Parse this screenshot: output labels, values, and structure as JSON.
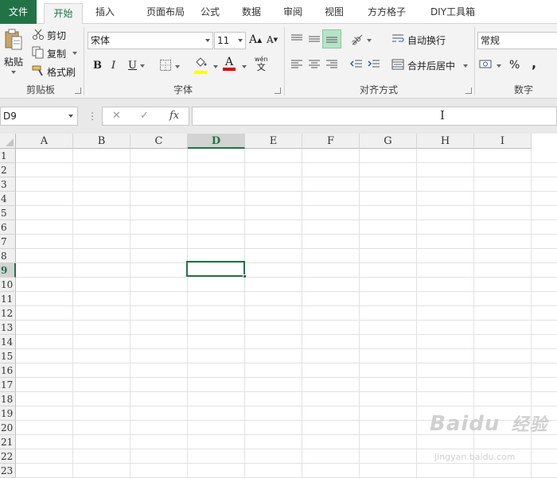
{
  "tabs": {
    "file": "文件",
    "home": "开始",
    "insert": "插入",
    "layout": "页面布局",
    "formulas": "公式",
    "data": "数据",
    "review": "审阅",
    "view": "视图",
    "fangfang": "方方格子",
    "diy": "DIY工具箱"
  },
  "clipboard": {
    "paste": "粘贴",
    "cut": "剪切",
    "copy": "复制",
    "format_painter": "格式刷",
    "group_label": "剪贴板"
  },
  "font": {
    "name": "宋体",
    "size": "11",
    "bold": "B",
    "italic": "I",
    "underline": "U",
    "grow": "A",
    "shrink": "A",
    "font_color_letter": "A",
    "phonetic_top": "wén",
    "phonetic_bottom": "文",
    "group_label": "字体"
  },
  "alignment": {
    "wrap_text": "自动换行",
    "merge_center": "合并后居中",
    "group_label": "对齐方式"
  },
  "number": {
    "format": "常规",
    "percent": "%",
    "comma": ",",
    "group_label": "数字"
  },
  "formula_bar": {
    "name_box": "D9",
    "cancel": "✕",
    "enter": "✓",
    "fx": "fx",
    "content": ""
  },
  "sheet": {
    "columns": [
      "A",
      "B",
      "C",
      "D",
      "E",
      "F",
      "G",
      "H",
      "I"
    ],
    "rows": [
      "1",
      "2",
      "3",
      "4",
      "5",
      "6",
      "7",
      "8",
      "9",
      "10",
      "11",
      "12",
      "13",
      "14",
      "15",
      "16",
      "17",
      "18",
      "19",
      "20",
      "21",
      "22",
      "23"
    ],
    "active_cell": "D9"
  },
  "watermark": {
    "brand": "Baidu",
    "brand_cn": "经验",
    "url": "jingyan.baidu.com"
  },
  "colors": {
    "accent": "#217346",
    "fill_highlight": "#ffff00",
    "font_red": "#e00000"
  }
}
